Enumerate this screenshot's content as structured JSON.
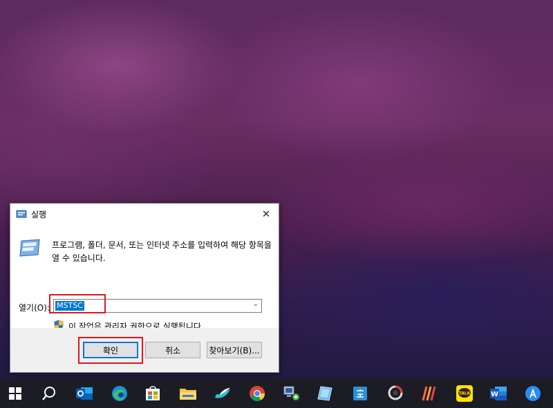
{
  "dialog": {
    "title": "실행",
    "close_glyph": "✕",
    "description": "프로그램, 폴더, 문서, 또는 인터넷 주소를 입력하여 해당 항목을 열 수 있습니다.",
    "open_label": "열기(O):",
    "input_value": "MSTSC",
    "admin_note": "이 작업은 관리자 권한으로 실행됩니다.",
    "ok_label": "확인",
    "cancel_label": "취소",
    "browse_label": "찾아보기(B)..."
  },
  "taskbar": {
    "items": [
      {
        "name": "start-button",
        "icon": "windows-logo-icon"
      },
      {
        "name": "search-button",
        "icon": "search-icon"
      },
      {
        "name": "outlook-app",
        "icon": "outlook-icon"
      },
      {
        "name": "edge-app",
        "icon": "edge-icon"
      },
      {
        "name": "store-app",
        "icon": "store-icon"
      },
      {
        "name": "file-explorer-app",
        "icon": "folder-icon"
      },
      {
        "name": "app-bird",
        "icon": "bird-icon"
      },
      {
        "name": "chrome-app",
        "icon": "chrome-icon"
      },
      {
        "name": "app-network",
        "icon": "network-computer-icon"
      },
      {
        "name": "app-glass",
        "icon": "glass-icon"
      },
      {
        "name": "hangul-app",
        "icon": "hangul-icon"
      },
      {
        "name": "photoscape-app",
        "icon": "photoscape-icon"
      },
      {
        "name": "app-stripes",
        "icon": "stripes-icon"
      },
      {
        "name": "kakaotalk-app",
        "icon": "kakaotalk-icon",
        "label": "TALK"
      },
      {
        "name": "word-app",
        "icon": "word-icon",
        "label": "W"
      },
      {
        "name": "app-blue-circle",
        "icon": "blue-circle-icon"
      }
    ]
  },
  "colors": {
    "accent": "#0078d7",
    "highlight_box": "#e0141e",
    "taskbar": "#1c1c24"
  }
}
